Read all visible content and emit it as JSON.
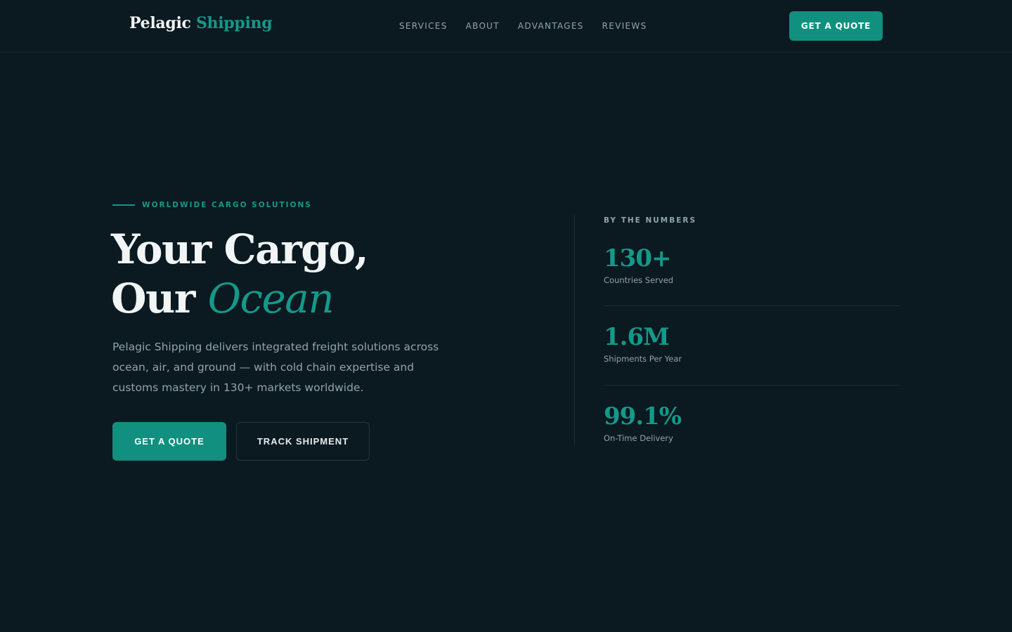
{
  "header": {
    "logo_primary": "Pelagic",
    "logo_accent": "Shipping",
    "nav": [
      "SERVICES",
      "ABOUT",
      "ADVANTAGES",
      "REVIEWS"
    ],
    "cta_label": "GET A QUOTE"
  },
  "hero": {
    "eyebrow": "WORLDWIDE CARGO SOLUTIONS",
    "title_line1": "Your Cargo,",
    "title_line2_prefix": "Our",
    "title_line2_accent": "Ocean",
    "description": "Pelagic Shipping delivers integrated freight solutions across ocean, air, and ground — with cold chain expertise and customs mastery in 130+ markets worldwide.",
    "primary_button": "GET A QUOTE",
    "secondary_button": "TRACK SHIPMENT"
  },
  "stats": {
    "label": "BY THE NUMBERS",
    "items": [
      {
        "value": "130+",
        "caption": "Countries Served"
      },
      {
        "value": "1.6M",
        "caption": "Shipments Per Year"
      },
      {
        "value": "99.1%",
        "caption": "On-Time Delivery"
      }
    ]
  },
  "colors": {
    "background": "#0b1920",
    "accent": "#14998a",
    "button": "#11907f",
    "muted_text": "#8ea5ac"
  }
}
